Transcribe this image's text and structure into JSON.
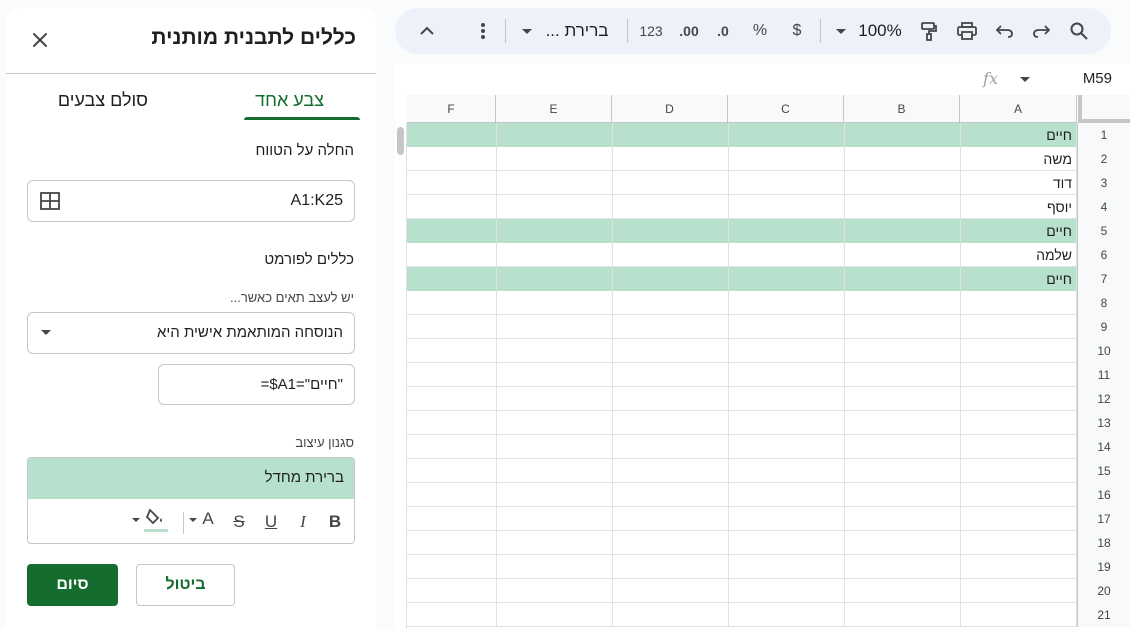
{
  "sidebar": {
    "title": "כללים לתבנית מותנית",
    "tabs": {
      "single": "צבע אחד",
      "scale": "סולם צבעים"
    },
    "apply_label": "החלה על הטווח",
    "range_value": "A1:K25",
    "rules_label": "כללים לפורמט",
    "condition_label": "יש לעצב תאים כאשר...",
    "condition_value": "הנוסחה המותאמת אישית היא",
    "formula_value": "=$A1=\"חיים\"",
    "style_label": "סגנון עיצוב",
    "style_preview": "ברירת מחדל",
    "format_buttons": {
      "bold": "B",
      "italic": "I",
      "underline": "U",
      "strike": "S",
      "text_color": "A"
    },
    "fill_color": "#b7e1cd",
    "done": "סיום",
    "cancel": "ביטול"
  },
  "toolbar": {
    "zoom": "100%",
    "currency": "$",
    "percent": "%",
    "dec_decrease": ".0",
    "dec_increase": ".00",
    "number_format": "123",
    "font": "ברירת ..."
  },
  "formula_bar": {
    "name_box": "M59",
    "fx": "fx"
  },
  "grid": {
    "columns": [
      "A",
      "B",
      "C",
      "D",
      "E",
      "F"
    ],
    "rows": [
      {
        "num": "1",
        "a": "חיים",
        "highlight": true
      },
      {
        "num": "2",
        "a": "משה",
        "highlight": false
      },
      {
        "num": "3",
        "a": "דוד",
        "highlight": false
      },
      {
        "num": "4",
        "a": "יוסף",
        "highlight": false
      },
      {
        "num": "5",
        "a": "חיים",
        "highlight": true
      },
      {
        "num": "6",
        "a": "שלמה",
        "highlight": false
      },
      {
        "num": "7",
        "a": "חיים",
        "highlight": true
      },
      {
        "num": "8",
        "a": "",
        "highlight": false
      },
      {
        "num": "9",
        "a": "",
        "highlight": false
      },
      {
        "num": "10",
        "a": "",
        "highlight": false
      },
      {
        "num": "11",
        "a": "",
        "highlight": false
      },
      {
        "num": "12",
        "a": "",
        "highlight": false
      },
      {
        "num": "13",
        "a": "",
        "highlight": false
      },
      {
        "num": "14",
        "a": "",
        "highlight": false
      },
      {
        "num": "15",
        "a": "",
        "highlight": false
      },
      {
        "num": "16",
        "a": "",
        "highlight": false
      },
      {
        "num": "17",
        "a": "",
        "highlight": false
      },
      {
        "num": "18",
        "a": "",
        "highlight": false
      },
      {
        "num": "19",
        "a": "",
        "highlight": false
      },
      {
        "num": "20",
        "a": "",
        "highlight": false
      },
      {
        "num": "21",
        "a": "",
        "highlight": false
      }
    ]
  },
  "colors": {
    "accent": "#146c2e",
    "highlight": "#b7e1cd",
    "toolbar_bg": "#edf2fa"
  }
}
